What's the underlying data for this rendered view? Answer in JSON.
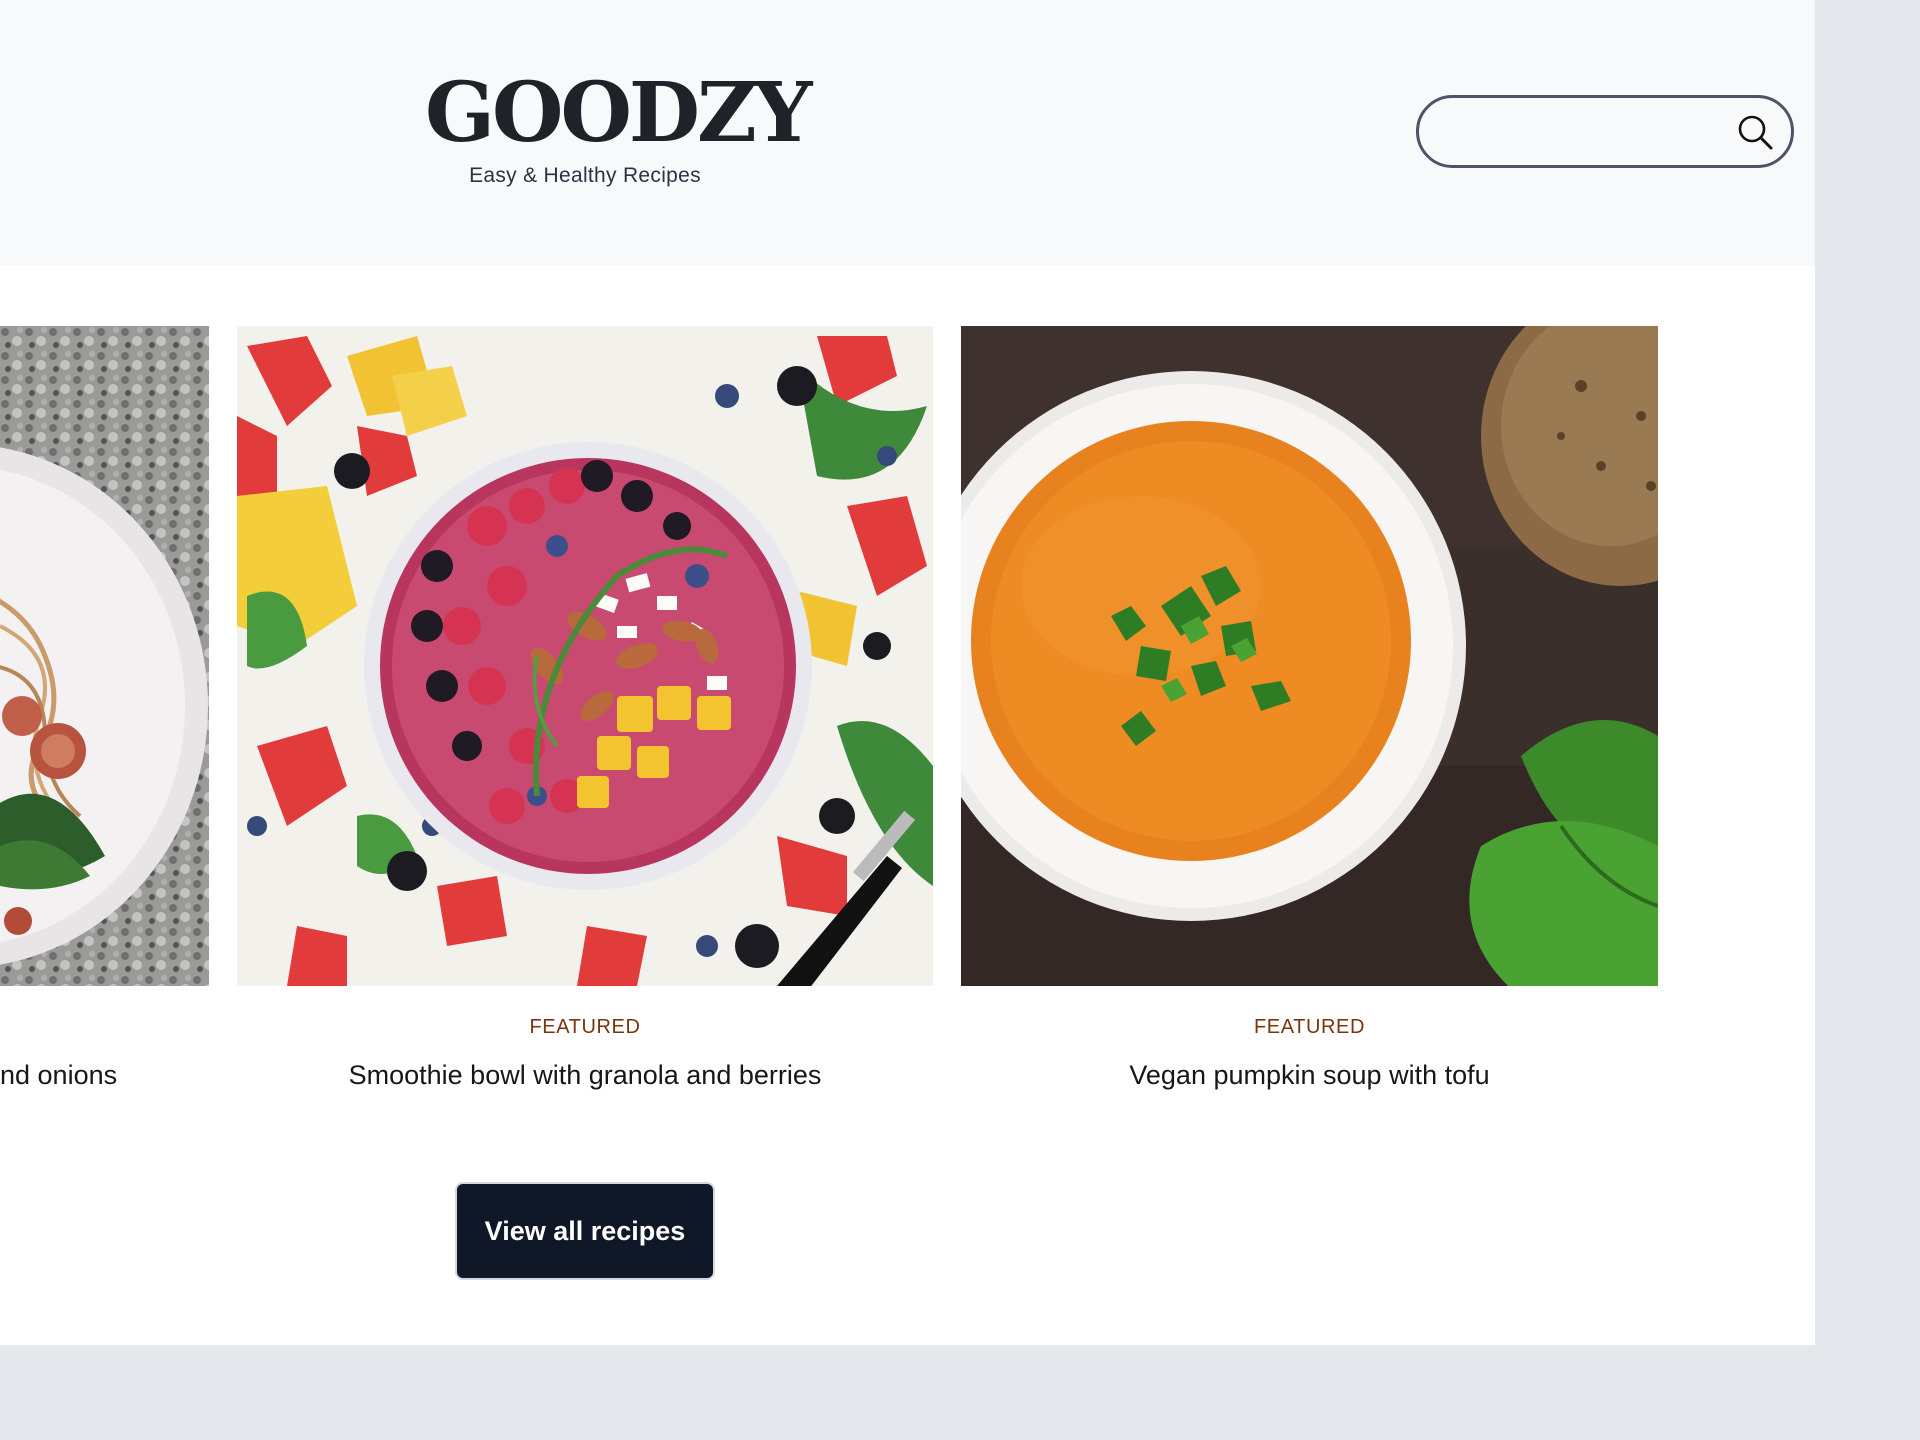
{
  "header": {
    "logo_title": "GOODZY",
    "logo_tagline": "Easy & Healthy Recipes",
    "search": {
      "placeholder": "",
      "value": ""
    },
    "search_icon": "search-icon"
  },
  "cards": [
    {
      "label": "",
      "title": "nd onions",
      "image": "pasta-plate-photo"
    },
    {
      "label": "FEATURED",
      "title": "Smoothie bowl with granola and berries",
      "image": "smoothie-bowl-photo"
    },
    {
      "label": "FEATURED",
      "title": "Vegan pumpkin soup with tofu",
      "image": "pumpkin-soup-photo"
    }
  ],
  "view_all_label": "View all recipes",
  "colors": {
    "header_bg": "#f8f9fb",
    "label": "#7a3410",
    "button_bg": "#101828",
    "outer_bg": "#e4e7eb"
  }
}
